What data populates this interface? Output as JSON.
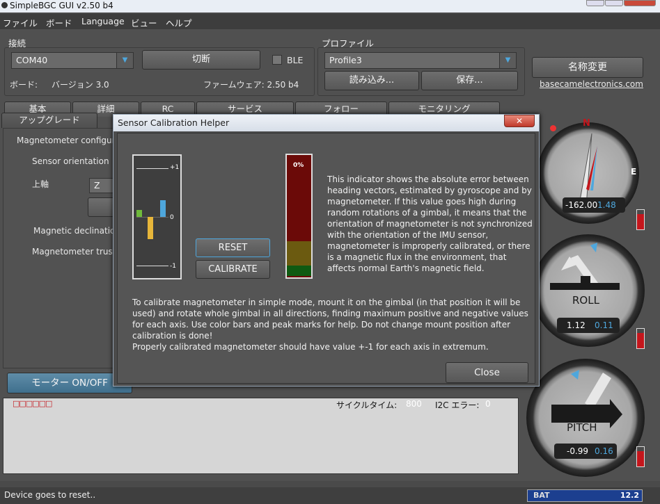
{
  "app": {
    "title": "SimpleBGC GUI v2.50 b4"
  },
  "menu": [
    "ファイル",
    "ボード",
    "Language",
    "ビュー",
    "ヘルプ"
  ],
  "connection": {
    "group_label": "接続",
    "port": "COM40",
    "disconnect_label": "切断",
    "ble_label": "BLE",
    "ble_checked": false,
    "board_label": "ボード:",
    "board_version": "バージョン 3.0",
    "firmware_label": "ファームウェア: 2.50 b4"
  },
  "profile": {
    "group_label": "プロファイル",
    "current": "Profile3",
    "load_label": "読み込み...",
    "save_label": "保存...",
    "rename_label": "名称変更",
    "link": "basecamelectronics.com"
  },
  "tabs_row1": [
    "基本",
    "詳細",
    "RC",
    "サービス",
    "フォロー",
    "モニタリング"
  ],
  "tabs_row2": [
    "アップグレード"
  ],
  "magnetometer": {
    "section_title": "Magnetometer configurat",
    "sensor_orientation_label": "Sensor orientation",
    "top_axis_label": "上軸",
    "top_axis_value": "Z",
    "declination_label": "Magnetic declination",
    "trust_label": "Magnetometer trust:"
  },
  "motor_button": "モーター ON/OFF",
  "log": {
    "indicators": "□□□□□□",
    "cycle_label": "サイクルタイム:",
    "cycle_value": "800",
    "i2c_label": "I2C エラー:",
    "i2c_value": "0"
  },
  "status": {
    "message": "Device goes to reset..",
    "bat_label": "BAT",
    "bat_value": "12.2"
  },
  "dialog": {
    "title": "Sensor Calibration Helper",
    "close_x": "✕",
    "scale_top": "+1",
    "scale_mid": "0",
    "scale_bottom": "-1",
    "error_value": "0%",
    "reset_label": "RESET",
    "calibrate_label": "CALIBRATE",
    "close_label": "Close",
    "description": "This indicator shows the absolute error between heading vectors, estimated by gyroscope and by magnetometer. If this value goes high during random rotations of a gimbal, it means that the orientation of magnetometer is not synchronized with the orientation of the IMU sensor, magnetometer is improperly calibrated, or there is a magnetic flux in the environment, that affects normal Earth's magnetic field.",
    "instructions_1": "To calibrate magnetometer in simple mode, mount it on the gimbal (in that position it will be used) and rotate whole gimbal in all directions, finding maximum positive and negative values for each axis. Use color bars and peak marks for help. Do not change mount position after calibration is done!",
    "instructions_2": "Properly calibrated magnetometer should have value +-1 for each axis in extremum.",
    "axis_values": [
      0.15,
      -0.45,
      0.35
    ],
    "axis_colors": [
      "#6fba3b",
      "#e7b63a",
      "#4ea7dd"
    ]
  },
  "gauges": {
    "compass": {
      "north": "N",
      "east": "E",
      "value1": "-162.00",
      "value2": "1.48"
    },
    "roll": {
      "label": "ROLL",
      "value1": "1.12",
      "value2": "0.11"
    },
    "pitch": {
      "label": "PITCH",
      "value1": "-0.99",
      "value2": "0.16"
    }
  },
  "colors": {
    "accent": "#4ea7dd",
    "danger": "#c4161c",
    "background": "#505050"
  }
}
